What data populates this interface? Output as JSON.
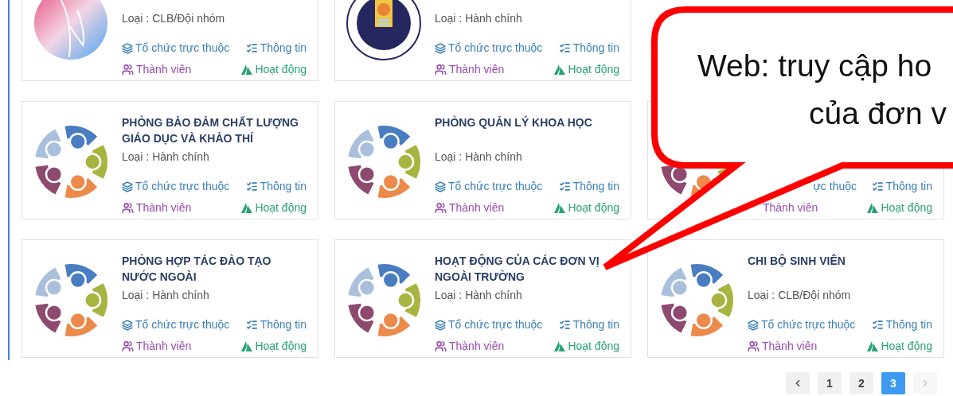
{
  "rows": [
    {
      "cards": [
        {
          "kind": "heart",
          "type": "Loại : CLB/Đội nhóm",
          "links": [
            {
              "kind": "subunit",
              "label": "Tổ chức trực thuộc"
            },
            {
              "kind": "info",
              "label": "Thông tin"
            },
            {
              "kind": "members",
              "label": "Thành viên"
            },
            {
              "kind": "activity",
              "label": "Hoạt động"
            }
          ]
        },
        {
          "kind": "seal",
          "type": "Loại : Hành chính",
          "links": [
            {
              "kind": "subunit",
              "label": "Tổ chức trực thuộc"
            },
            {
              "kind": "info",
              "label": "Thông tin"
            },
            {
              "kind": "members",
              "label": "Thành viên"
            },
            {
              "kind": "activity",
              "label": "Hoạt động"
            }
          ]
        }
      ]
    },
    {
      "cards": [
        {
          "kind": "people",
          "title": "PHÒNG BẢO ĐẢM CHẤT LƯỢNG GIÁO DỤC VÀ KHẢO THÍ",
          "type": "Loại : Hành chính",
          "links": [
            {
              "kind": "subunit",
              "label": "Tổ chức trực thuộc"
            },
            {
              "kind": "info",
              "label": "Thông tin"
            },
            {
              "kind": "members",
              "label": "Thành viên"
            },
            {
              "kind": "activity",
              "label": "Hoạt động"
            }
          ]
        },
        {
          "kind": "people",
          "title": "PHÒNG QUẢN LÝ KHOA HỌC",
          "type": "Loại : Hành chính",
          "links": [
            {
              "kind": "subunit",
              "label": "Tổ chức trực thuộc"
            },
            {
              "kind": "info",
              "label": "Thông tin"
            },
            {
              "kind": "members",
              "label": "Thành viên"
            },
            {
              "kind": "activity",
              "label": "Hoạt động"
            }
          ]
        },
        {
          "kind": "people",
          "links": [
            {
              "kind": "partial_subunit",
              "label": "ực thuộc"
            },
            {
              "kind": "info",
              "label": "Thông tin"
            },
            {
              "kind": "partial_members",
              "label": "Thành viên"
            },
            {
              "kind": "activity",
              "label": "Hoạt động"
            }
          ]
        }
      ]
    },
    {
      "cards": [
        {
          "kind": "people",
          "title": "PHÒNG HỢP TÁC ĐÀO TẠO NƯỚC NGOÀI",
          "type": "Loại : Hành chính",
          "links": [
            {
              "kind": "subunit",
              "label": "Tổ chức trực thuộc"
            },
            {
              "kind": "info",
              "label": "Thông tin"
            },
            {
              "kind": "members",
              "label": "Thành viên"
            },
            {
              "kind": "activity",
              "label": "Hoạt động"
            }
          ]
        },
        {
          "kind": "people",
          "title": "HOẠT ĐỘNG CỦA CÁC ĐƠN VỊ NGOÀI TRƯỜNG",
          "type": "Loại : Hành chính",
          "links": [
            {
              "kind": "subunit",
              "label": "Tổ chức trực thuộc"
            },
            {
              "kind": "info",
              "label": "Thông tin"
            },
            {
              "kind": "members",
              "label": "Thành viên"
            },
            {
              "kind": "activity",
              "label": "Hoạt động"
            }
          ]
        },
        {
          "kind": "people",
          "title": "CHI BỘ SINH VIÊN",
          "type": "Loại : CLB/Đội nhóm",
          "links": [
            {
              "kind": "subunit",
              "label": "Tổ chức trực thuộc"
            },
            {
              "kind": "info",
              "label": "Thông tin"
            },
            {
              "kind": "members",
              "label": "Thành viên"
            },
            {
              "kind": "activity",
              "label": "Hoạt động"
            }
          ]
        }
      ]
    }
  ],
  "pagination": {
    "prev": {
      "disabled": false
    },
    "pages": [
      {
        "label": "1",
        "selected": false
      },
      {
        "label": "2",
        "selected": false
      },
      {
        "label": "3",
        "selected": true
      }
    ],
    "next": {
      "disabled": true
    }
  },
  "callout": {
    "lines": [
      "Web: truy cập ho",
      "của đơn v"
    ]
  }
}
